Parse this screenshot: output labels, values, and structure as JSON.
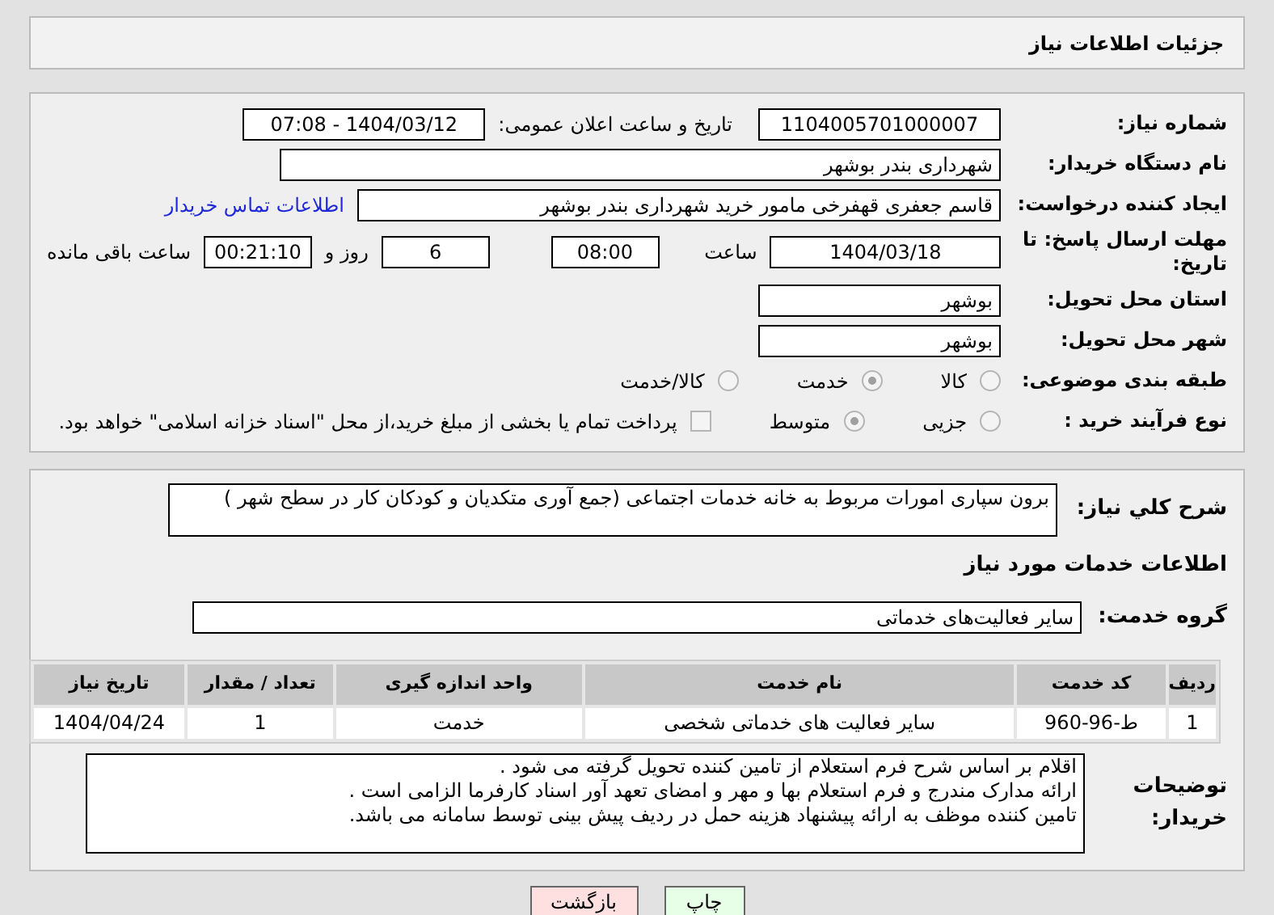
{
  "header": {
    "title": "جزئیات اطلاعات نیاز"
  },
  "need_number": {
    "label": "شماره نیاز:",
    "value": "1104005701000007"
  },
  "announce": {
    "label": "تاریخ و ساعت اعلان عمومی:",
    "value": "1404/03/12 - 07:08"
  },
  "buyer": {
    "label": "نام دستگاه خریدار:",
    "value": "شهرداری بندر بوشهر"
  },
  "creator": {
    "label": "ایجاد کننده درخواست:",
    "value": "قاسم جعفری قهفرخی مامور خرید  شهرداری بندر بوشهر",
    "link": "اطلاعات تماس خریدار"
  },
  "deadline": {
    "label": "مهلت ارسال پاسخ: تا تاریخ:",
    "date": "1404/03/18",
    "time_label": "ساعت",
    "time": "08:00",
    "days": "6",
    "days_label": "روز و",
    "remaining": "00:21:10",
    "remaining_label": "ساعت باقی مانده"
  },
  "province": {
    "label": "استان محل تحویل:",
    "value": "بوشهر"
  },
  "city": {
    "label": "شهر محل تحویل:",
    "value": "بوشهر"
  },
  "category": {
    "label": "طبقه بندی موضوعی:",
    "options": [
      {
        "label": "کالا",
        "selected": false
      },
      {
        "label": "خدمت",
        "selected": true
      },
      {
        "label": "کالا/خدمت",
        "selected": false
      }
    ]
  },
  "process": {
    "label": "نوع فرآیند خرید :",
    "options": [
      {
        "label": "جزیی",
        "selected": false
      },
      {
        "label": "متوسط",
        "selected": true
      }
    ],
    "payment": {
      "checked": false,
      "label": "پرداخت تمام یا بخشی از مبلغ خرید،از محل \"اسناد خزانه اسلامی\" خواهد بود."
    }
  },
  "summary": {
    "label": "شرح کلي نیاز:",
    "value": "برون سپاری امورات مربوط به خانه خدمات اجتماعی (جمع آوری متکدیان و کودکان کار در سطح شهر )"
  },
  "services_heading": "اطلاعات خدمات مورد نیاز",
  "service_group": {
    "label": "گروه خدمت:",
    "value": "سایر فعالیت‌های خدماتی"
  },
  "table": {
    "columns": [
      "ردیف",
      "کد خدمت",
      "نام خدمت",
      "واحد اندازه گیری",
      "تعداد / مقدار",
      "تاریخ نیاز"
    ],
    "rows": [
      [
        "1",
        "ط-96-960",
        "سایر فعالیت های خدماتی شخصی",
        "خدمت",
        "1",
        "1404/04/24"
      ]
    ]
  },
  "notes": {
    "label": "توضیحات خریدار:",
    "lines": [
      "اقلام بر اساس شرح فرم استعلام از تامین کننده تحویل گرفته می شود .",
      "ارائه مدارک مندرج و فرم استعلام بها و مهر و امضای تعهد آور اسناد کارفرما الزامی است .",
      "تامین  کننده موظف به ارائه پیشنهاد هزینه حمل در ردیف پیش بینی توسط سامانه می باشد."
    ]
  },
  "buttons": [
    {
      "label": "چاپ",
      "kind": "print"
    },
    {
      "label": "بازگشت",
      "kind": "back"
    }
  ]
}
